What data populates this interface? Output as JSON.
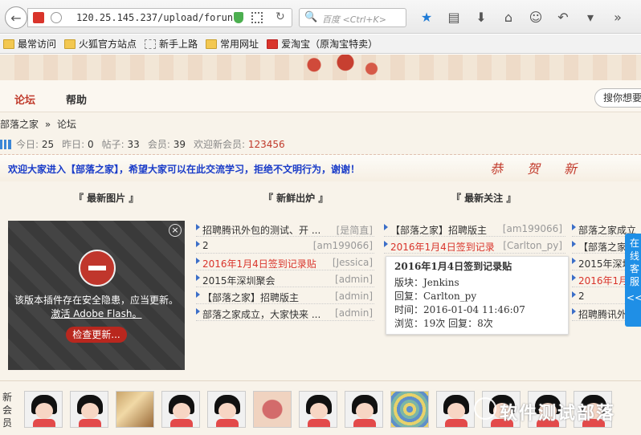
{
  "browser": {
    "url": "120.25.145.237/upload/forun",
    "search_placeholder": "百度 <Ctrl+K>",
    "bookmarks": [
      "最常访问",
      "火狐官方站点",
      "新手上路",
      "常用网址",
      "爱淘宝（原淘宝特卖）"
    ]
  },
  "nav": {
    "items": [
      "论坛",
      "帮助"
    ],
    "search_label": "搜你想要"
  },
  "breadcrumb": {
    "home": "部落之家",
    "sep": "»",
    "current": "论坛"
  },
  "stats": {
    "today_label": "今日:",
    "today": "25",
    "yesterday_label": "昨日:",
    "yesterday": "0",
    "posts_label": "帖子:",
    "posts": "33",
    "members_label": "会员:",
    "members": "39",
    "newest_label": "欢迎新会员:",
    "newest": "123456"
  },
  "welcome": {
    "text": "欢迎大家进入【部落之家】，希望大家可以在此交流学习，拒绝不文明行为，谢谢！",
    "art": "恭贺新"
  },
  "columns": {
    "images": "『 最新图片 』",
    "fresh": "『 新鲜出炉 』",
    "focus": "『 最新关注 』"
  },
  "flash": {
    "message": "该版本插件存在安全隐患，应当更新。",
    "activate": "激活 Adobe Flash。",
    "button": "检查更新...",
    "close": "×"
  },
  "fresh_list": [
    {
      "title": "招聘腾讯外包的测试、开 ...",
      "author": "[是简直]",
      "red": false
    },
    {
      "title": "2",
      "author": "[am199066]",
      "red": false
    },
    {
      "title": "2016年1月4日签到记录贴",
      "author": "[Jessica]",
      "red": true
    },
    {
      "title": "2015年深圳聚会",
      "author": "[admin]",
      "red": false
    },
    {
      "title": "【部落之家】招聘版主",
      "author": "[admin]",
      "red": false
    },
    {
      "title": "部落之家成立，大家快来 ...",
      "author": "[admin]",
      "red": false
    }
  ],
  "focus_list": [
    {
      "title": "【部落之家】招聘版主",
      "author": "[am199066]",
      "red": false
    },
    {
      "title": "2016年1月4日签到记录",
      "author": "[Carlton_py]",
      "red": true
    }
  ],
  "extra_list": [
    {
      "title": "部落之家成立",
      "red": false
    },
    {
      "title": "【部落之家",
      "red": false
    },
    {
      "title": "2015年深圳",
      "red": false
    },
    {
      "title": "2016年1月",
      "red": true
    },
    {
      "title": "2",
      "red": false
    },
    {
      "title": "招聘腾讯外",
      "red": false
    }
  ],
  "tooltip": {
    "title": "2016年1月4日签到记录贴",
    "board": "版块：Jenkins",
    "reply": "回复：Carlton_py",
    "time": "时间：2016-01-04 11:46:07",
    "views": "浏览：19次  回复：8次"
  },
  "side_tab": {
    "text": "在线客服",
    "chevron": "<<"
  },
  "members_section": {
    "label": "新会员",
    "watermark": "软件测试部落"
  }
}
